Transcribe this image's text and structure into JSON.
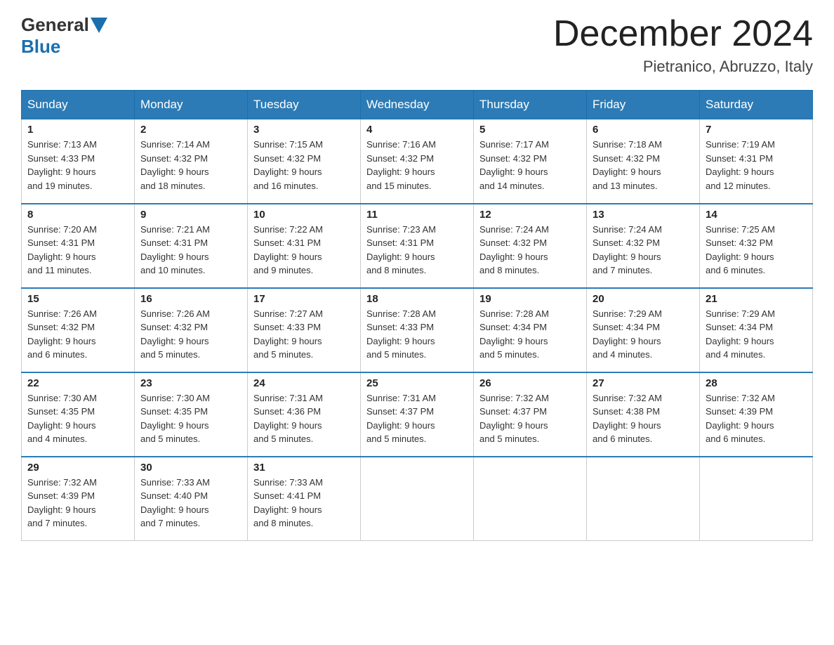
{
  "header": {
    "logo_general": "General",
    "logo_blue": "Blue",
    "month_year": "December 2024",
    "location": "Pietranico, Abruzzo, Italy"
  },
  "weekdays": [
    "Sunday",
    "Monday",
    "Tuesday",
    "Wednesday",
    "Thursday",
    "Friday",
    "Saturday"
  ],
  "weeks": [
    [
      {
        "day": "1",
        "sunrise": "7:13 AM",
        "sunset": "4:33 PM",
        "daylight": "9 hours and 19 minutes."
      },
      {
        "day": "2",
        "sunrise": "7:14 AM",
        "sunset": "4:32 PM",
        "daylight": "9 hours and 18 minutes."
      },
      {
        "day": "3",
        "sunrise": "7:15 AM",
        "sunset": "4:32 PM",
        "daylight": "9 hours and 16 minutes."
      },
      {
        "day": "4",
        "sunrise": "7:16 AM",
        "sunset": "4:32 PM",
        "daylight": "9 hours and 15 minutes."
      },
      {
        "day": "5",
        "sunrise": "7:17 AM",
        "sunset": "4:32 PM",
        "daylight": "9 hours and 14 minutes."
      },
      {
        "day": "6",
        "sunrise": "7:18 AM",
        "sunset": "4:32 PM",
        "daylight": "9 hours and 13 minutes."
      },
      {
        "day": "7",
        "sunrise": "7:19 AM",
        "sunset": "4:31 PM",
        "daylight": "9 hours and 12 minutes."
      }
    ],
    [
      {
        "day": "8",
        "sunrise": "7:20 AM",
        "sunset": "4:31 PM",
        "daylight": "9 hours and 11 minutes."
      },
      {
        "day": "9",
        "sunrise": "7:21 AM",
        "sunset": "4:31 PM",
        "daylight": "9 hours and 10 minutes."
      },
      {
        "day": "10",
        "sunrise": "7:22 AM",
        "sunset": "4:31 PM",
        "daylight": "9 hours and 9 minutes."
      },
      {
        "day": "11",
        "sunrise": "7:23 AM",
        "sunset": "4:31 PM",
        "daylight": "9 hours and 8 minutes."
      },
      {
        "day": "12",
        "sunrise": "7:24 AM",
        "sunset": "4:32 PM",
        "daylight": "9 hours and 8 minutes."
      },
      {
        "day": "13",
        "sunrise": "7:24 AM",
        "sunset": "4:32 PM",
        "daylight": "9 hours and 7 minutes."
      },
      {
        "day": "14",
        "sunrise": "7:25 AM",
        "sunset": "4:32 PM",
        "daylight": "9 hours and 6 minutes."
      }
    ],
    [
      {
        "day": "15",
        "sunrise": "7:26 AM",
        "sunset": "4:32 PM",
        "daylight": "9 hours and 6 minutes."
      },
      {
        "day": "16",
        "sunrise": "7:26 AM",
        "sunset": "4:32 PM",
        "daylight": "9 hours and 5 minutes."
      },
      {
        "day": "17",
        "sunrise": "7:27 AM",
        "sunset": "4:33 PM",
        "daylight": "9 hours and 5 minutes."
      },
      {
        "day": "18",
        "sunrise": "7:28 AM",
        "sunset": "4:33 PM",
        "daylight": "9 hours and 5 minutes."
      },
      {
        "day": "19",
        "sunrise": "7:28 AM",
        "sunset": "4:34 PM",
        "daylight": "9 hours and 5 minutes."
      },
      {
        "day": "20",
        "sunrise": "7:29 AM",
        "sunset": "4:34 PM",
        "daylight": "9 hours and 4 minutes."
      },
      {
        "day": "21",
        "sunrise": "7:29 AM",
        "sunset": "4:34 PM",
        "daylight": "9 hours and 4 minutes."
      }
    ],
    [
      {
        "day": "22",
        "sunrise": "7:30 AM",
        "sunset": "4:35 PM",
        "daylight": "9 hours and 4 minutes."
      },
      {
        "day": "23",
        "sunrise": "7:30 AM",
        "sunset": "4:35 PM",
        "daylight": "9 hours and 5 minutes."
      },
      {
        "day": "24",
        "sunrise": "7:31 AM",
        "sunset": "4:36 PM",
        "daylight": "9 hours and 5 minutes."
      },
      {
        "day": "25",
        "sunrise": "7:31 AM",
        "sunset": "4:37 PM",
        "daylight": "9 hours and 5 minutes."
      },
      {
        "day": "26",
        "sunrise": "7:32 AM",
        "sunset": "4:37 PM",
        "daylight": "9 hours and 5 minutes."
      },
      {
        "day": "27",
        "sunrise": "7:32 AM",
        "sunset": "4:38 PM",
        "daylight": "9 hours and 6 minutes."
      },
      {
        "day": "28",
        "sunrise": "7:32 AM",
        "sunset": "4:39 PM",
        "daylight": "9 hours and 6 minutes."
      }
    ],
    [
      {
        "day": "29",
        "sunrise": "7:32 AM",
        "sunset": "4:39 PM",
        "daylight": "9 hours and 7 minutes."
      },
      {
        "day": "30",
        "sunrise": "7:33 AM",
        "sunset": "4:40 PM",
        "daylight": "9 hours and 7 minutes."
      },
      {
        "day": "31",
        "sunrise": "7:33 AM",
        "sunset": "4:41 PM",
        "daylight": "9 hours and 8 minutes."
      },
      null,
      null,
      null,
      null
    ]
  ],
  "labels": {
    "sunrise": "Sunrise:",
    "sunset": "Sunset:",
    "daylight": "Daylight:"
  }
}
